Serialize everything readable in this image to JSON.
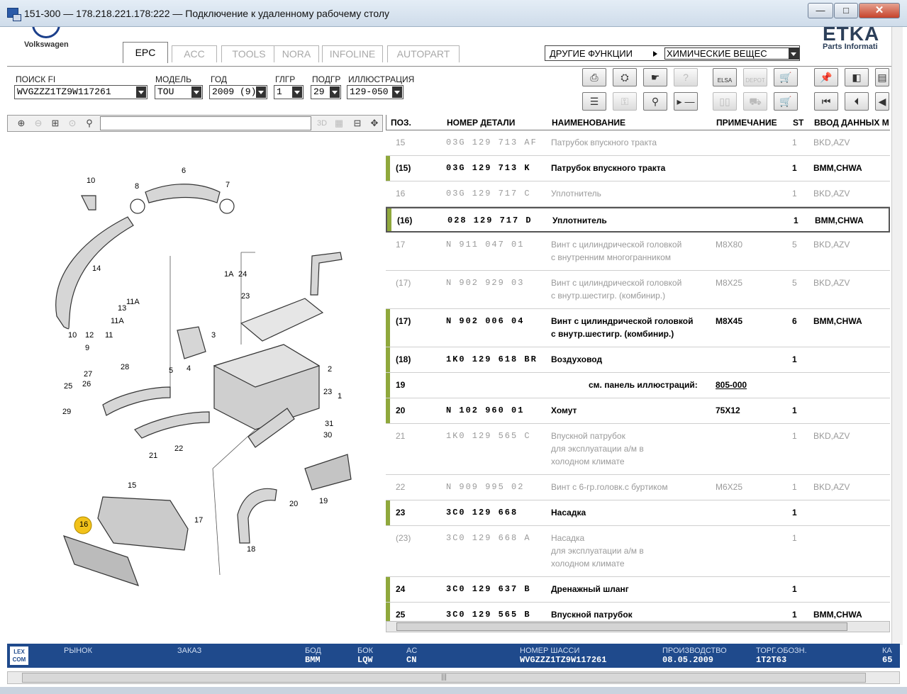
{
  "window": {
    "title": "151-300 — 178.218.221.178:222 — Подключение к удаленному рабочему столу",
    "min": "—",
    "max": "□",
    "close": "✕"
  },
  "header": {
    "brand": "Volkswagen",
    "tabs": [
      "EPC",
      "ACC",
      "TOOLS",
      "NORA",
      "INFOLINE",
      "AUTOPART"
    ],
    "other_functions": "ДРУГИЕ ФУНКЦИИ",
    "other_functions_value": "ХИМИЧЕСКИЕ ВЕЩЕС",
    "etka_logo": "ETKA",
    "etka_sub": "Parts Informati"
  },
  "vehicle": {
    "search_label": "ПОИСК FI",
    "search_value": "WVGZZZ1TZ9W117261",
    "model_label": "МОДЕЛЬ",
    "model_value": "TOU",
    "year_label": "ГОД",
    "year_value": "2009 (9)",
    "group_label": "ГЛГР",
    "group_value": "1",
    "subgroup_label": "ПОДГР",
    "subgroup_value": "29",
    "illustration_label": "ИЛЛЮСТРАЦИЯ",
    "illustration_value": "129-050"
  },
  "toolbar": {
    "btn_elsa": "ELSA",
    "btn_depot": "DEPOT"
  },
  "parts_header": {
    "pos": "ПОЗ.",
    "number": "НОМЕР ДЕТАЛИ",
    "name": "НАИМЕНОВАНИЕ",
    "note": "ПРИМЕЧАНИЕ",
    "st": "ST",
    "input": "ВВОД ДАННЫХ М"
  },
  "parts": [
    {
      "pos": "15",
      "num": "03G  129  713  AF",
      "name": "Патрубок впускного тракта",
      "note": "",
      "st": "1",
      "data": "BKD,AZV",
      "state": "grey"
    },
    {
      "pos": "(15)",
      "num": "03G  129  713  K",
      "name": "Патрубок впускного тракта",
      "note": "",
      "st": "1",
      "data": "BMM,CHWA",
      "state": "act"
    },
    {
      "pos": "16",
      "num": "03G  129  717  C",
      "name": "Уплотнитель",
      "note": "",
      "st": "1",
      "data": "BKD,AZV",
      "state": "grey"
    },
    {
      "pos": "(16)",
      "num": "028  129  717  D",
      "name": "Уплотнитель",
      "note": "",
      "st": "1",
      "data": "BMM,CHWA",
      "state": "act"
    },
    {
      "pos": "17",
      "num": "N     911  047  01",
      "name": "Винт с цилиндрической головкой\nс внутренним многогранником",
      "note": "M8X80",
      "st": "5",
      "data": "BKD,AZV",
      "state": "grey"
    },
    {
      "pos": "(17)",
      "num": "N     902  929  03",
      "name": "Винт с цилиндрической головкой\nс внутр.шестигр. (комбинир.)",
      "note": "M8X25",
      "st": "5",
      "data": "BKD,AZV",
      "state": "grey"
    },
    {
      "pos": "(17)",
      "num": "N     902  006  04",
      "name": "Винт с цилиндрической головкой\nс внутр.шестигр. (комбинир.)",
      "note": "M8X45",
      "st": "6",
      "data": "BMM,CHWA",
      "state": "act"
    },
    {
      "pos": "(18)",
      "num": "1K0  129  618  BR",
      "name": "Воздуховод",
      "note": "",
      "st": "1",
      "data": "",
      "state": "act"
    },
    {
      "pos": "19",
      "num": "",
      "name": "см. панель иллюстраций:",
      "note": "805-000",
      "st": "",
      "data": "",
      "state": "ref"
    },
    {
      "pos": "20",
      "num": "N     102  960  01",
      "name": "Хомут",
      "note": "75X12",
      "st": "1",
      "data": "",
      "state": "act"
    },
    {
      "pos": "21",
      "num": "1K0  129  565  C",
      "name": "Впускной патрубок\nдля эксплуатации а/м в\nхолодном климате",
      "note": "",
      "st": "1",
      "data": "BKD,AZV",
      "state": "grey"
    },
    {
      "pos": "22",
      "num": "N     909  995  02",
      "name": "Винт с 6-гр.головк.с буртиком",
      "note": "M6X25",
      "st": "1",
      "data": "BKD,AZV",
      "state": "grey"
    },
    {
      "pos": "23",
      "num": "3C0  129  668",
      "name": "Насадка",
      "note": "",
      "st": "1",
      "data": "",
      "state": "act"
    },
    {
      "pos": "(23)",
      "num": "3C0  129  668  A",
      "name": "Насадка\nдля эксплуатации а/м в\nхолодном климате",
      "note": "",
      "st": "1",
      "data": "",
      "state": "grey"
    },
    {
      "pos": "24",
      "num": "3C0  129  637  B",
      "name": "Дренажный шланг",
      "note": "",
      "st": "1",
      "data": "",
      "state": "act"
    },
    {
      "pos": "25",
      "num": "3C0  129  565  B",
      "name": "Впускной патрубок",
      "note": "",
      "st": "1",
      "data": "BMM,CHWA",
      "state": "act"
    }
  ],
  "illustration_labels": [
    "10",
    "8",
    "6",
    "7",
    "14",
    "1A",
    "24",
    "23",
    "12",
    "13",
    "11A",
    "11A",
    "9",
    "11",
    "10",
    "3",
    "5",
    "4",
    "2",
    "23",
    "1",
    "28",
    "27",
    "26",
    "25",
    "29",
    "22",
    "21",
    "31",
    "30",
    "15",
    "17",
    "16",
    "20",
    "19",
    "18"
  ],
  "status": {
    "lexcom": "LEX COM",
    "market_label": "РЫНОК",
    "market_value": "",
    "order_label": "ЗАКАЗ",
    "order_value": "",
    "bod_label": "БОД",
    "bod_value": "BMM",
    "bok_label": "БОК",
    "bok_value": "LQW",
    "ac_label": "AC",
    "ac_value": "CN",
    "chassis_label": "НОМЕР ШАССИ",
    "chassis_value": "WVGZZZ1TZ9W117261",
    "prod_label": "ПРОИЗВОДСТВО",
    "prod_value": "08.05.2009",
    "trade_label": "ТОРГ.ОБОЗН.",
    "trade_value": "1T2T63",
    "extra_label": "КА",
    "extra_value": "65"
  },
  "colors": {
    "accent_bar": "#8fa83c",
    "status_bg": "#1f4a8c",
    "highlight": "#f2c21a"
  }
}
